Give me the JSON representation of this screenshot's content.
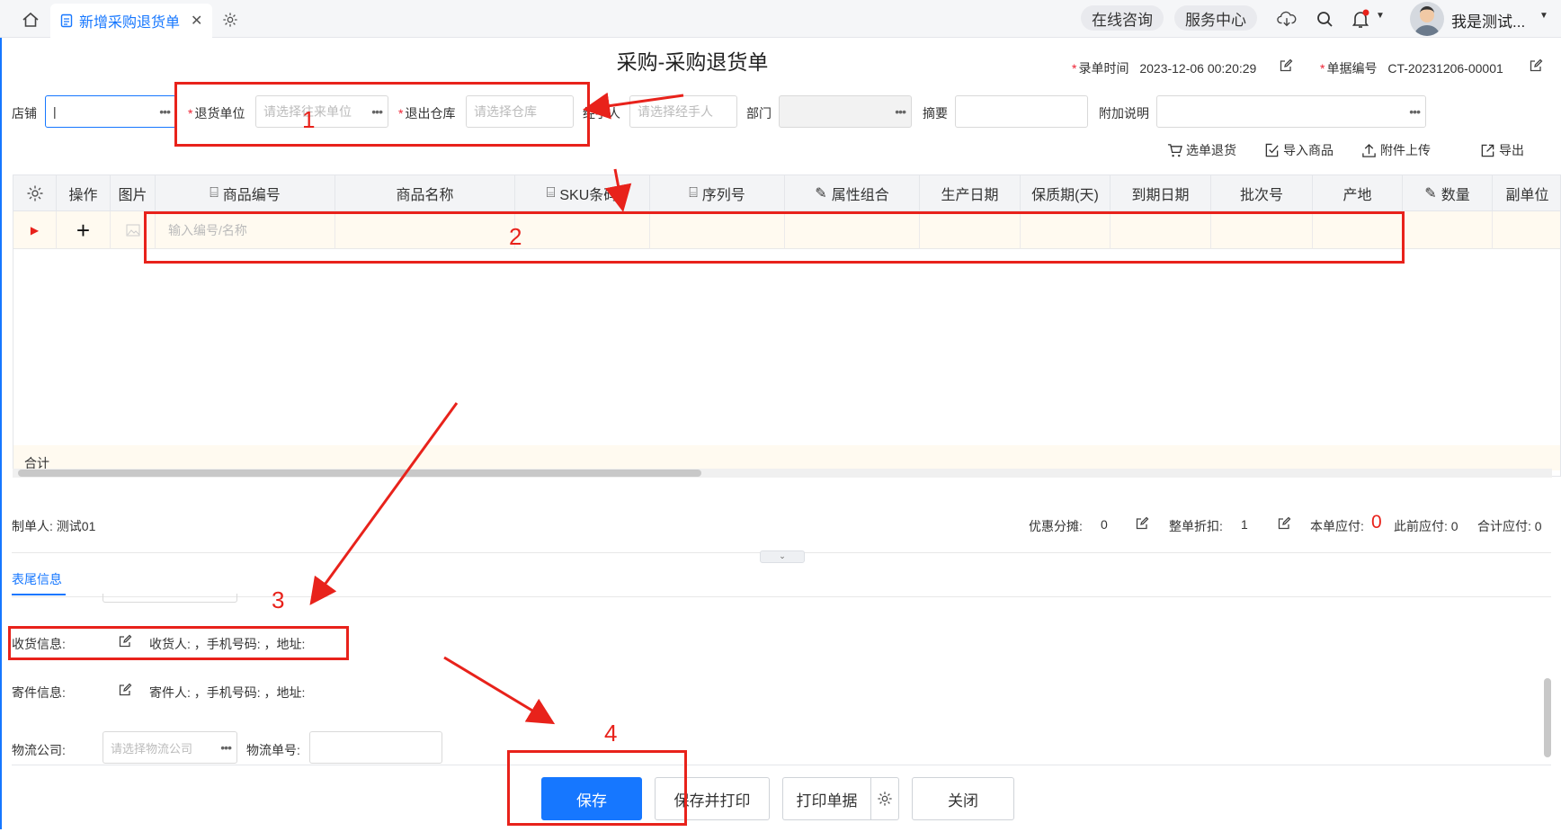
{
  "topbar": {
    "tab_label": "新增采购退货单",
    "online_consult": "在线咨询",
    "service_center": "服务中心",
    "user_name": "我是测试..."
  },
  "header": {
    "title": "采购-采购退货单",
    "record_time_label": "录单时间",
    "record_time_value": "2023-12-06 00:20:29",
    "doc_no_label": "单据编号",
    "doc_no_value": "CT-20231206-00001"
  },
  "form": {
    "store_label": "店铺",
    "store_value": "|",
    "return_unit_label": "退货单位",
    "return_unit_placeholder": "请选择往来单位",
    "warehouse_label": "退出仓库",
    "warehouse_placeholder": "请选择仓库",
    "handler_label": "经手人",
    "handler_placeholder": "请选择经手人",
    "dept_label": "部门",
    "summary_label": "摘要",
    "extra_label": "附加说明"
  },
  "toolbar": {
    "select_return": "选单退货",
    "import_goods": "导入商品",
    "upload_attach": "附件上传",
    "export": "导出"
  },
  "grid": {
    "columns": [
      "操作",
      "图片",
      "商品编号",
      "商品名称",
      "SKU条码",
      "序列号",
      "属性组合",
      "生产日期",
      "保质期(天)",
      "到期日期",
      "批次号",
      "产地",
      "数量",
      "副单位"
    ],
    "row_placeholder": "输入编号/名称",
    "sum_label": "合计"
  },
  "summary": {
    "creator": "制单人: 测试01",
    "discount_share_label": "优惠分摊:",
    "discount_share_value": "0",
    "whole_discount_label": "整单折扣:",
    "whole_discount_value": "1",
    "payable_label": "本单应付:",
    "payable_value": "0",
    "prev_payable": "此前应付: 0",
    "total_payable": "合计应付: 0"
  },
  "footer": {
    "tab": "表尾信息",
    "receive_label": "收货信息:",
    "receive_detail": "收货人: ，手机号码: ，地址:",
    "send_label": "寄件信息:",
    "send_detail": "寄件人: ，手机号码: ，地址:",
    "logistics_label": "物流公司:",
    "logistics_placeholder": "请选择物流公司",
    "tracking_label": "物流单号:"
  },
  "buttons": {
    "save": "保存",
    "save_print": "保存并打印",
    "print_doc": "打印单据",
    "close": "关闭"
  },
  "annotations": [
    "1",
    "2",
    "3",
    "4"
  ],
  "colors": {
    "accent": "#1677ff",
    "annotation": "#e8221b",
    "row_highlight": "#fffaf0"
  }
}
